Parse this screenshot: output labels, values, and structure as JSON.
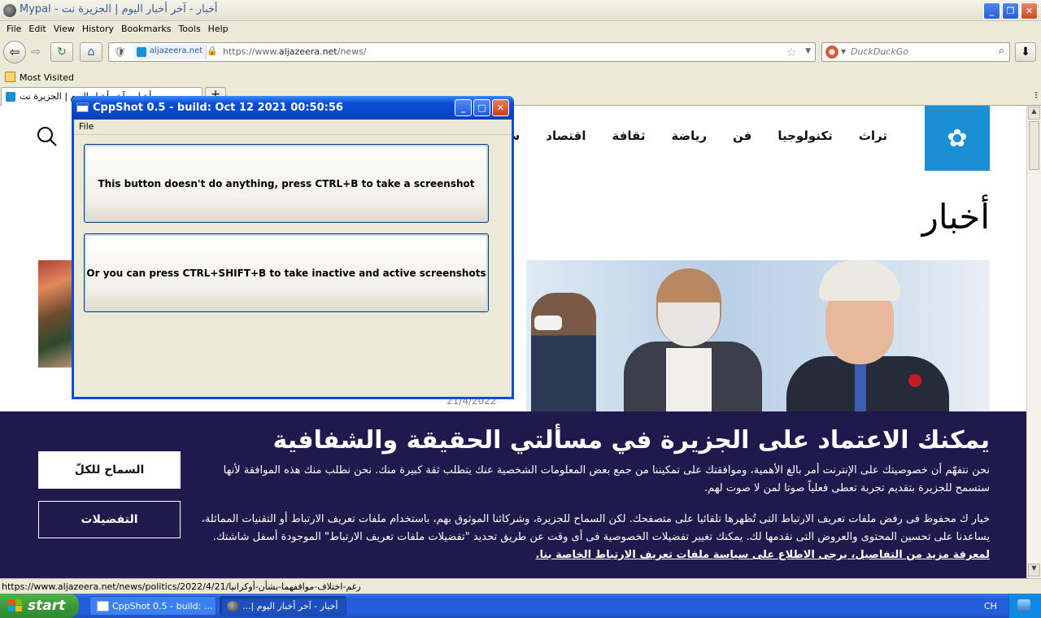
{
  "browser": {
    "window_title": "أخبار - آخر أخبار اليوم | الجزيرة نت - Mypal",
    "menu": [
      "File",
      "Edit",
      "View",
      "History",
      "Bookmarks",
      "Tools",
      "Help"
    ],
    "site_identity": "aljazeera.net",
    "url_prefix": "https://www.",
    "url_domain": "aljazeera.net",
    "url_path": "/news/",
    "search_placeholder": "DuckDuckGo",
    "bookmark": "Most Visited",
    "tab_title": "أخبار - آخر أخبار اليوم | الجزيرة نت",
    "status_url": "https://www.aljazeera.net/news/politics/2022/4/21/رغم-اختلاف-مواقفهما-بشأن-أوكرانيا",
    "icons": [
      "back-icon",
      "forward-icon",
      "reload-icon",
      "home-icon",
      "shield-icon",
      "lock-icon",
      "star-icon",
      "search-icon",
      "download-icon"
    ]
  },
  "site": {
    "nav": [
      "سياسة",
      "اقتصاد",
      "ثقافة",
      "رياضة",
      "فن",
      "تكنولوجيا",
      "تراث"
    ],
    "heading": "أخبار",
    "date": "21/4/2022",
    "brand_color": "#1b8fd6"
  },
  "cookie": {
    "title": "يمكنك الاعتماد على الجزيرة في مسألتي الحقيقة والشفافية",
    "p1": "نحن نتفهّم أن خصوصيتك على الإنترنت أمر بالغ الأهمية، وموافقتك على تمكيننا من جمع بعض المعلومات الشخصية عنك يتطلب ثقة كبيرة منك. نحن نطلب منك هذه الموافقة لأنها ستسمح للجزيرة بتقديم تجربة تعطى فعلياً صوتا لمن لا صوت لهم.",
    "p2": "خيار ك محفوظ فى رفض ملفات تعريف الارتباط التى تُظهرها تلقائيا على متصفحك. لكن السماح للجزيرة، وشركائنا الموثوق بهم، باستخدام ملفات تعريف الارتباط أو التقنيات المماثلة، يساعدنا على تحسين المحتوى والعروض التى نقدمها لك. يمكنك تغيير تفضيلات الخصوصية فى أى وقت عن طريق تحديد \"تفضيلات ملفات تعريف الارتباط\" الموجودة أسفل شاشتك.",
    "link": "لمعرفة مزيد من التفاصيل، يرجى الاطلاع على سياسة ملفات تعريف الارتباط الخاصة بنا.",
    "allow_button": "السماح للكلّ",
    "prefs_button": "التفضيلات",
    "bg_color": "#20194e"
  },
  "cppshot": {
    "title": "CppShot 0.5 - build: Oct 12 2021 00:50:56",
    "menu": "File",
    "button1": "This button doesn't do anything, press CTRL+B to take a screenshot",
    "button2": "Or you can press CTRL+SHIFT+B to take inactive and active screenshots"
  },
  "taskbar": {
    "start": "start",
    "tasks": [
      "CppShot 0.5 - build: ...",
      "أخبار - آخر أخبار اليوم |..."
    ],
    "lang": "CH"
  }
}
